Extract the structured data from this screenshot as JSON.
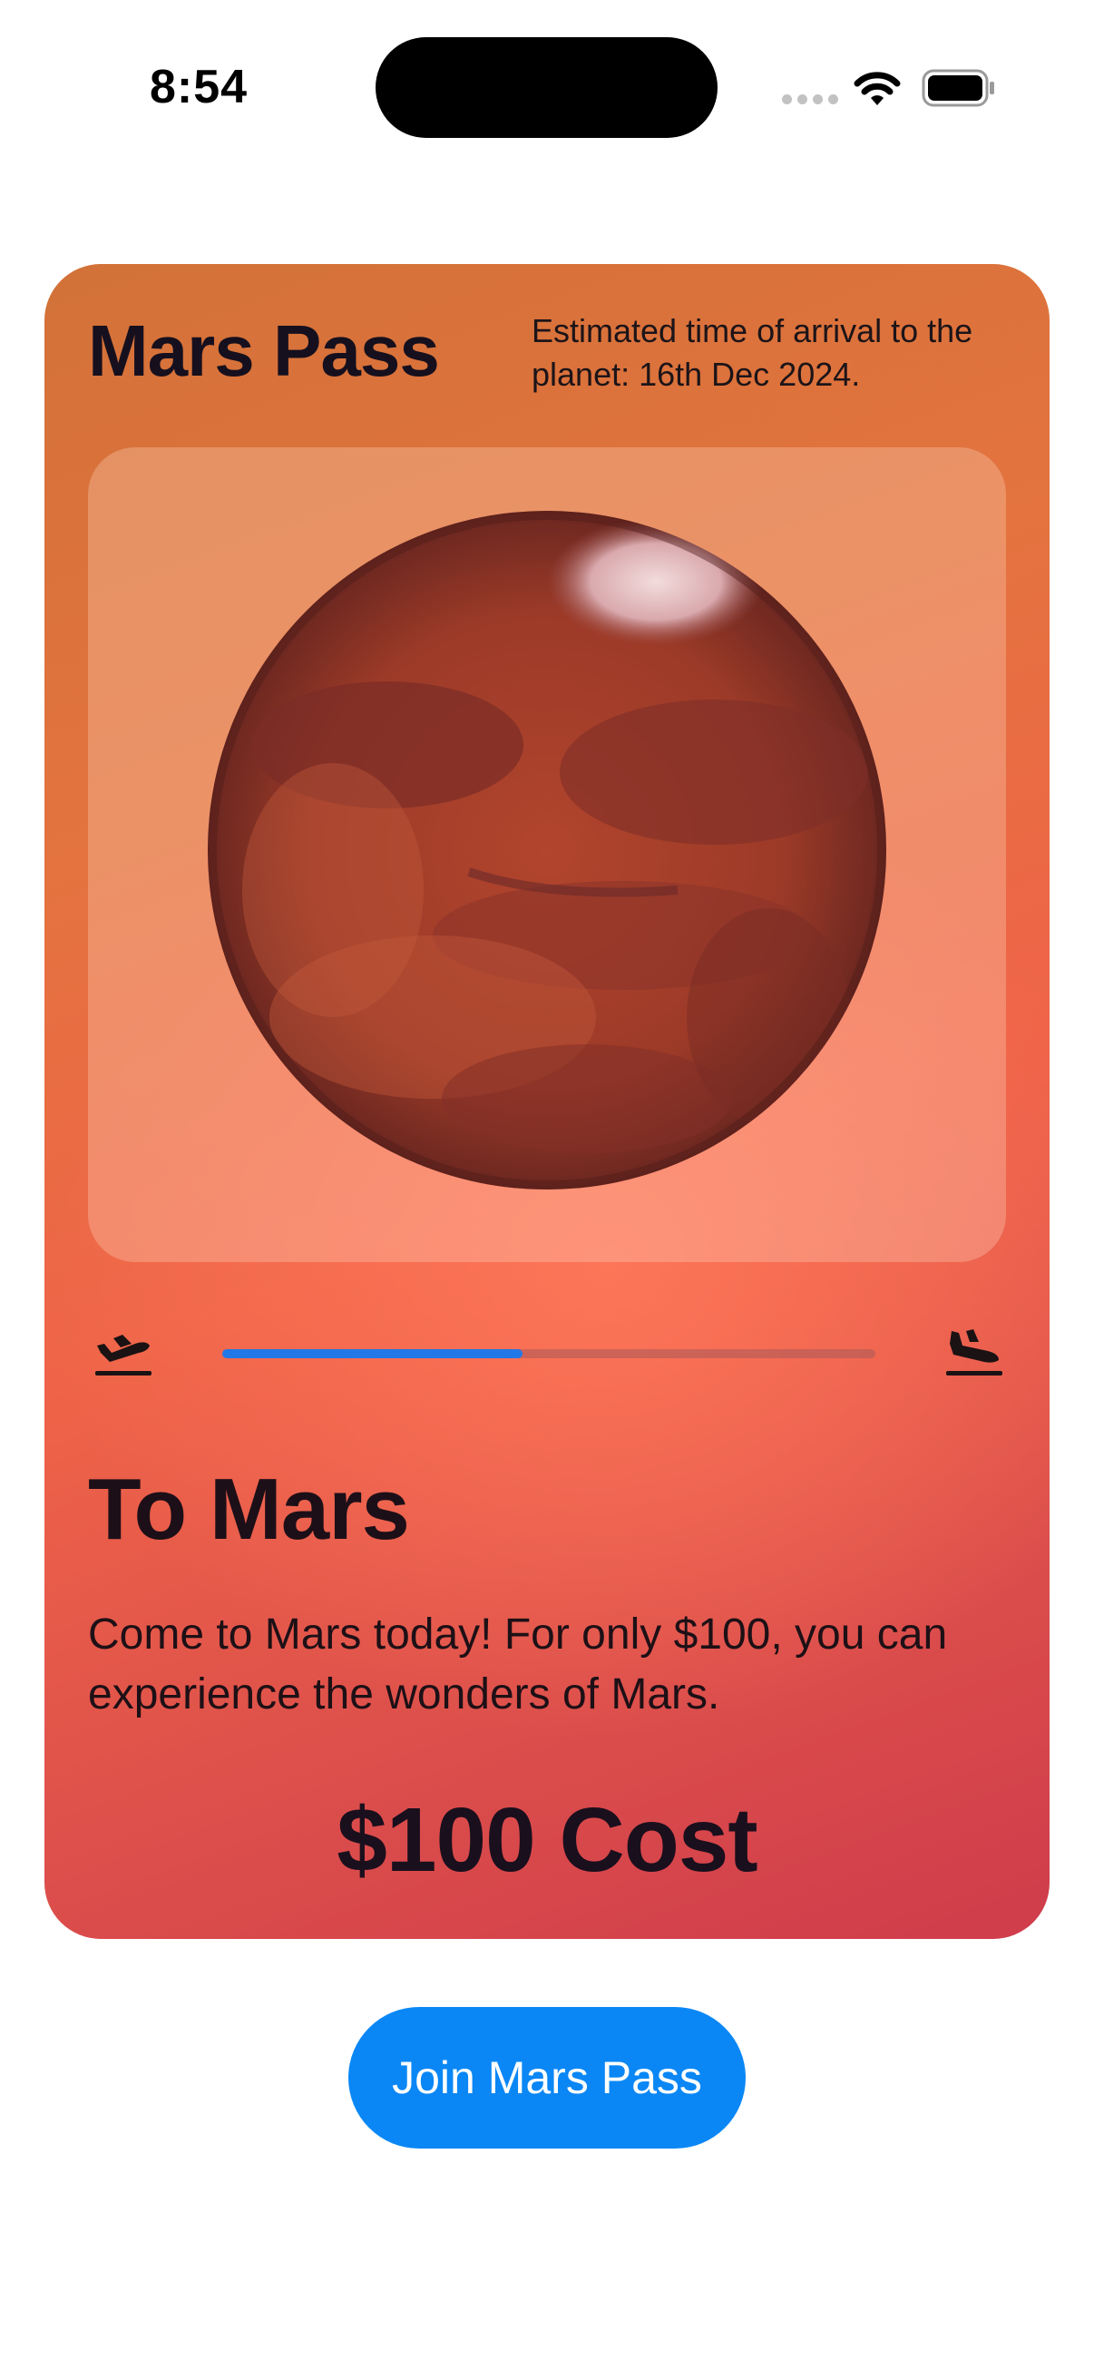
{
  "status_bar": {
    "time": "8:54",
    "icons": [
      "cellular-signal-icon",
      "wifi-icon",
      "battery-icon"
    ]
  },
  "card": {
    "title": "Mars Pass",
    "eta_text": "Estimated time of arrival to the planet: 16th Dec 2024.",
    "image": "mars-planet",
    "trip_progress": 0.46,
    "depart_icon": "airplane-departure-icon",
    "arrive_icon": "airplane-arrival-icon",
    "destination_title": "To Mars",
    "description": "Come to Mars today! For only $100, you can experience the wonders of Mars.",
    "cost_label": "$100 Cost",
    "colors": {
      "gradient_top": "#d27238",
      "gradient_bottom": "#cf3c4b",
      "progress": "#2378e8"
    }
  },
  "join_button": {
    "label": "Join Mars Pass",
    "color": "#0a87f5"
  }
}
